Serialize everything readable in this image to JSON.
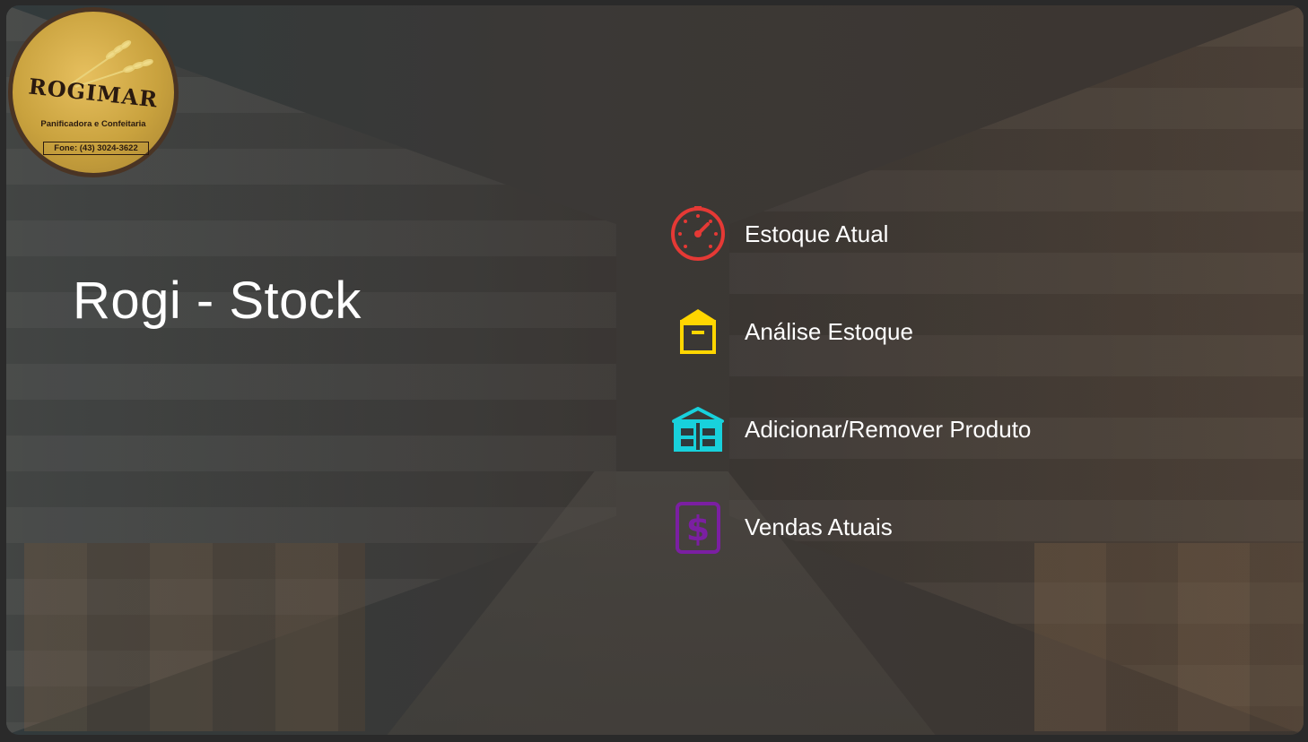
{
  "app": {
    "title": "Rogi - Stock"
  },
  "logo": {
    "brand": "ROGIMAR",
    "subtitle": "Panificadora e Confeitaria",
    "phone": "Fone: (43) 3024-3622"
  },
  "menu": {
    "items": [
      {
        "label": "Estoque Atual",
        "icon": "speedometer-icon",
        "color": "#e53935"
      },
      {
        "label": "Análise Estoque",
        "icon": "box-icon",
        "color": "#ffd600"
      },
      {
        "label": "Adicionar/Remover Produto",
        "icon": "warehouse-icon",
        "color": "#18d1dc"
      },
      {
        "label": "Vendas Atuais",
        "icon": "dollar-icon",
        "color": "#7b1fa2"
      }
    ]
  }
}
